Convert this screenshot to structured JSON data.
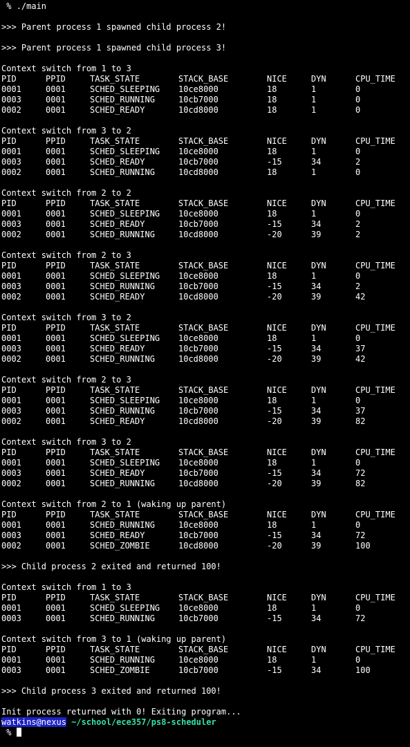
{
  "window": {
    "app": "terminal"
  },
  "command": {
    "prompt_symbol": " %",
    "text": "./main"
  },
  "spawn_messages": [
    ">>> Parent process 1 spawned child process 2!",
    ">>> Parent process 1 spawned child process 3!"
  ],
  "headers": [
    "PID",
    "PPID",
    "TASK_STATE",
    "STACK_BASE",
    "NICE",
    "DYN",
    "CPU_TIME"
  ],
  "switches": [
    {
      "title": "Context switch from 1 to 3",
      "rows": [
        [
          "0001",
          "0001",
          "SCHED_SLEEPING",
          "10ce8000",
          "18",
          "1",
          "0"
        ],
        [
          "0003",
          "0001",
          "SCHED_RUNNING",
          "10cb7000",
          "18",
          "1",
          "0"
        ],
        [
          "0002",
          "0001",
          "SCHED_READY",
          "10cd8000",
          "18",
          "1",
          "0"
        ]
      ]
    },
    {
      "title": "Context switch from 3 to 2",
      "rows": [
        [
          "0001",
          "0001",
          "SCHED_SLEEPING",
          "10ce8000",
          "18",
          "1",
          "0"
        ],
        [
          "0003",
          "0001",
          "SCHED_READY",
          "10cb7000",
          "-15",
          "34",
          "2"
        ],
        [
          "0002",
          "0001",
          "SCHED_RUNNING",
          "10cd8000",
          "18",
          "1",
          "0"
        ]
      ]
    },
    {
      "title": "Context switch from 2 to 2",
      "rows": [
        [
          "0001",
          "0001",
          "SCHED_SLEEPING",
          "10ce8000",
          "18",
          "1",
          "0"
        ],
        [
          "0003",
          "0001",
          "SCHED_READY",
          "10cb7000",
          "-15",
          "34",
          "2"
        ],
        [
          "0002",
          "0001",
          "SCHED_RUNNING",
          "10cd8000",
          "-20",
          "39",
          "2"
        ]
      ]
    },
    {
      "title": "Context switch from 2 to 3",
      "rows": [
        [
          "0001",
          "0001",
          "SCHED_SLEEPING",
          "10ce8000",
          "18",
          "1",
          "0"
        ],
        [
          "0003",
          "0001",
          "SCHED_RUNNING",
          "10cb7000",
          "-15",
          "34",
          "2"
        ],
        [
          "0002",
          "0001",
          "SCHED_READY",
          "10cd8000",
          "-20",
          "39",
          "42"
        ]
      ]
    },
    {
      "title": "Context switch from 3 to 2",
      "rows": [
        [
          "0001",
          "0001",
          "SCHED_SLEEPING",
          "10ce8000",
          "18",
          "1",
          "0"
        ],
        [
          "0003",
          "0001",
          "SCHED_READY",
          "10cb7000",
          "-15",
          "34",
          "37"
        ],
        [
          "0002",
          "0001",
          "SCHED_RUNNING",
          "10cd8000",
          "-20",
          "39",
          "42"
        ]
      ]
    },
    {
      "title": "Context switch from 2 to 3",
      "rows": [
        [
          "0001",
          "0001",
          "SCHED_SLEEPING",
          "10ce8000",
          "18",
          "1",
          "0"
        ],
        [
          "0003",
          "0001",
          "SCHED_RUNNING",
          "10cb7000",
          "-15",
          "34",
          "37"
        ],
        [
          "0002",
          "0001",
          "SCHED_READY",
          "10cd8000",
          "-20",
          "39",
          "82"
        ]
      ]
    },
    {
      "title": "Context switch from 3 to 2",
      "rows": [
        [
          "0001",
          "0001",
          "SCHED_SLEEPING",
          "10ce8000",
          "18",
          "1",
          "0"
        ],
        [
          "0003",
          "0001",
          "SCHED_READY",
          "10cb7000",
          "-15",
          "34",
          "72"
        ],
        [
          "0002",
          "0001",
          "SCHED_RUNNING",
          "10cd8000",
          "-20",
          "39",
          "82"
        ]
      ]
    },
    {
      "title": "Context switch from 2 to 1 (waking up parent)",
      "rows": [
        [
          "0001",
          "0001",
          "SCHED_RUNNING",
          "10ce8000",
          "18",
          "1",
          "0"
        ],
        [
          "0003",
          "0001",
          "SCHED_READY",
          "10cb7000",
          "-15",
          "34",
          "72"
        ],
        [
          "0002",
          "0001",
          "SCHED_ZOMBIE",
          "10cd8000",
          "-20",
          "39",
          "100"
        ]
      ],
      "after": ">>> Child process 2 exited and returned 100!"
    },
    {
      "title": "Context switch from 1 to 3",
      "rows": [
        [
          "0001",
          "0001",
          "SCHED_SLEEPING",
          "10ce8000",
          "18",
          "1",
          "0"
        ],
        [
          "0003",
          "0001",
          "SCHED_RUNNING",
          "10cb7000",
          "-15",
          "34",
          "72"
        ]
      ]
    },
    {
      "title": "Context switch from 3 to 1 (waking up parent)",
      "rows": [
        [
          "0001",
          "0001",
          "SCHED_RUNNING",
          "10ce8000",
          "18",
          "1",
          "0"
        ],
        [
          "0003",
          "0001",
          "SCHED_ZOMBIE",
          "10cb7000",
          "-15",
          "34",
          "100"
        ]
      ],
      "after": ">>> Child process 3 exited and returned 100!"
    }
  ],
  "final_message": "Init process returned with 0! Exiting program...",
  "prompt": {
    "user_host": "watkins@nexus",
    "path": "~/school/ece357/ps8-scheduler",
    "symbol": " %"
  },
  "colors": {
    "background": "#000000",
    "foreground": "#ffffff",
    "user_highlight": "#1c22c4",
    "path": "#35e0a8"
  }
}
